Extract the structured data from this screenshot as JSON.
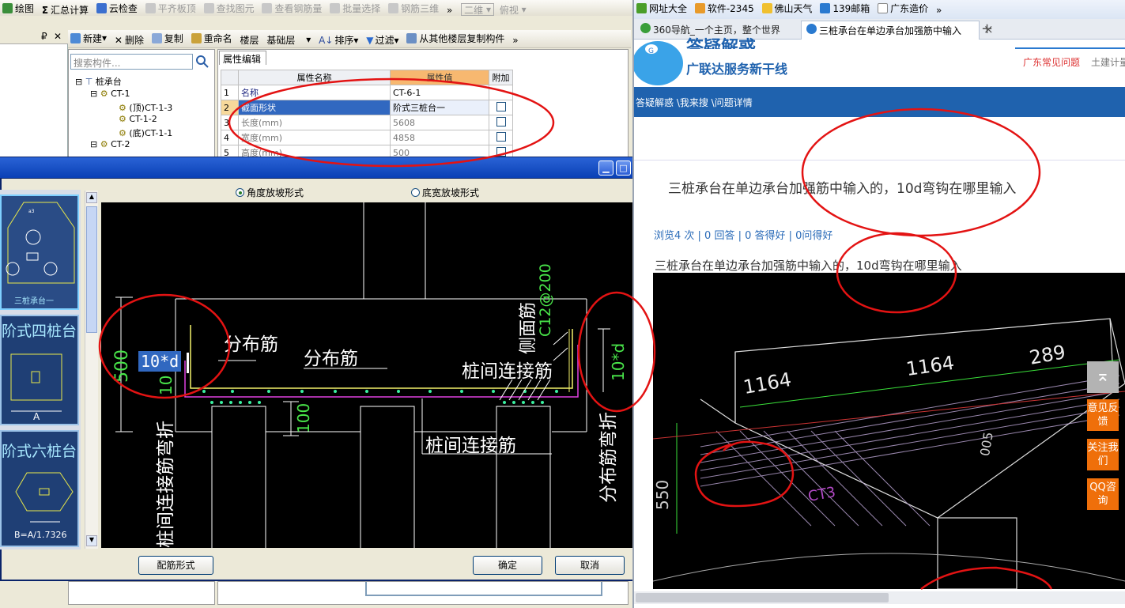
{
  "toolbar1": {
    "items": [
      "绘图",
      "汇总计算",
      "云检查",
      "平齐板顶",
      "查找图元",
      "查看钢筋量",
      "批量选择",
      "钢筋三维"
    ],
    "more": "»",
    "view2d": "二维",
    "viewmode": "俯视"
  },
  "toolbar2": {
    "items": [
      "新建",
      "删除",
      "复制",
      "重命名"
    ],
    "floor_label": "楼层",
    "floor_value": "基础层",
    "sort": "排序",
    "filter": "过滤",
    "copy_from": "从其他楼层复制构件",
    "more": "»"
  },
  "left_pane": {
    "pin": "₽",
    "close": "✕"
  },
  "tree": {
    "search_placeholder": "搜索构件...",
    "root": "桩承台",
    "nodes": [
      {
        "label": "CT-1",
        "level": 1,
        "expand": "⊟"
      },
      {
        "label": "(顶)CT-1-3",
        "level": 2
      },
      {
        "label": "CT-1-2",
        "level": 2
      },
      {
        "label": "(底)CT-1-1",
        "level": 2
      },
      {
        "label": "CT-2",
        "level": 1,
        "expand": "⊟"
      }
    ]
  },
  "properties": {
    "tab": "属性编辑",
    "headers": [
      "属性名称",
      "属性值",
      "附加"
    ],
    "rows": [
      {
        "num": "1",
        "name": "名称",
        "value": "CT-6-1",
        "has_check": false
      },
      {
        "num": "2",
        "name": "截面形状",
        "value": "阶式三桩台一",
        "has_check": true
      },
      {
        "num": "3",
        "name": "长度(mm)",
        "value": "5608",
        "has_check": true
      },
      {
        "num": "4",
        "name": "宽度(mm)",
        "value": "4858",
        "has_check": true
      },
      {
        "num": "5",
        "name": "高度(mm)",
        "value": "500",
        "has_check": true
      }
    ]
  },
  "dialog": {
    "radio_angle": "角度放坡形式",
    "radio_bottom": "底宽放坡形式",
    "thumbnails": [
      {
        "label": "三桩承台一",
        "dim": "a3"
      },
      {
        "label": "阶式四桩台",
        "dim": "A"
      },
      {
        "label": "阶式六桩台",
        "dim": "B=A/1.7326"
      }
    ],
    "cad": {
      "edit_value": "10*d",
      "dim_500": "500",
      "dim_10": "10",
      "dim_100": "100",
      "right_10d": "10*d",
      "side_c12": "C12@200",
      "labels": {
        "dist1": "分布筋",
        "dist2": "分布筋",
        "side": "侧面筋",
        "pile_conn1": "桩间连接筋",
        "pile_conn2": "桩间连接筋",
        "pile_bend": "桩间连接筋弯折",
        "dist_bend": "分布筋弯折"
      }
    },
    "btn_form": "配筋形式",
    "btn_ok": "确定",
    "btn_cancel": "取消"
  },
  "browser": {
    "favorites": [
      "网址大全",
      "软件-2345",
      "佛山天气",
      "139邮箱",
      "广东造价"
    ],
    "more": "»",
    "tabs": [
      {
        "title": "360导航_一个主页，整个世界",
        "active": false
      },
      {
        "title": "三桩承台在单边承台加强筋中输入",
        "active": true
      }
    ],
    "close_tab": "×",
    "new_tab": "+",
    "logo_title": "答疑解惑",
    "logo_subtitle": "广联达服务新干线",
    "links": [
      "广东常见问题",
      "土建计量"
    ],
    "breadcrumb": "答疑解惑 \\我来搜 \\问题详情",
    "question_title": "三桩承台在单边承台加强筋中输入的，10d弯钩在哪里输入",
    "stats": "浏览4 次 | 0 回答 | 0 答得好 | 0问得好",
    "question_body": "三桩承台在单边承台加强筋中输入的，10d弯钩在哪里输入",
    "photo_dims": [
      "1164",
      "1164",
      "289",
      "550",
      "005",
      "CT3"
    ],
    "side_buttons": [
      "意见反馈",
      "关注我们",
      "QQ咨询"
    ]
  }
}
